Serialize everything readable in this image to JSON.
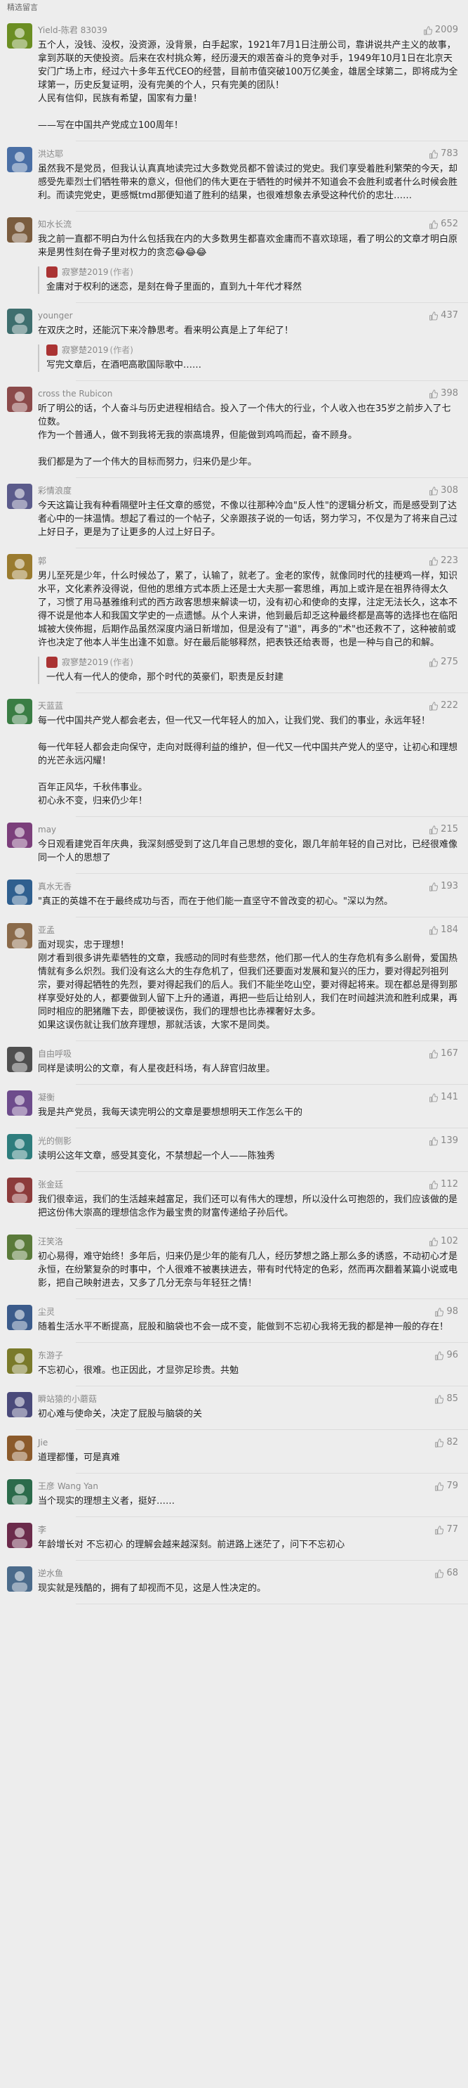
{
  "section_title": "精选留言",
  "author_name": "寂寥楚2019",
  "author_tag": "(作者)",
  "comments": [
    {
      "name": "Yield-陈君 83039",
      "likes": "2009",
      "text": "五个人，没钱、没权，没资源，没背景，白手起家，1921年7月1日注册公司，靠讲说共产主义的故事，拿到苏联的天使投资。后来在农村挑众筹，经历漫天的艰苦奋斗的竞争对手，1949年10月1日在北京天安门广场上市，经过六十多年五代CEO的经营，目前市值突破100万亿美金，雄居全球第二，即将成为全球第一，历史反复证明，没有完美的个人，只有完美的团队！\n人民有信仰，民族有希望，国家有力量！\n\n——写在中国共产党成立100周年！",
      "reply": null
    },
    {
      "name": "洪达耶",
      "likes": "783",
      "text": "虽然我不是党员，但我认认真真地读完过大多数党员都不曾读过的党史。我们享受着胜利繁荣的今天，却感受先辈烈士们牺牲带来的意义，但他们的伟大更在于牺牲的时候并不知道会不会胜利或者什么时候会胜利。而读完党史，更感慨tmd那便知道了胜利的结果，也很难想象去承受这种代价的忠壮……",
      "reply": null
    },
    {
      "name": "知水长流",
      "likes": "652",
      "text": "我之前一直都不明白为什么包括我在内的大多数男生都喜欢金庸而不喜欢琼瑶，看了明公的文章才明白原来是男性刻在骨子里对权力的贪恋😂😂😂",
      "reply": {
        "likes": "",
        "text": "金庸对于权利的迷恋，是刻在骨子里面的，直到九十年代才释然"
      }
    },
    {
      "name": "younger",
      "likes": "437",
      "text": "在双庆之时，还能沉下来冷静思考。看来明公真是上了年纪了！",
      "reply": {
        "likes": "",
        "text": "写完文章后，在酒吧高歌国际歌中……"
      }
    },
    {
      "name": "cross the Rubicon",
      "likes": "398",
      "text": "听了明公的话，个人奋斗与历史进程相结合。投入了一个伟大的行业，个人收入也在35岁之前步入了七位数。\n作为一个普通人，做不到我将无我的崇高境界，但能做到鸡鸣而起，奋不顾身。\n\n我们都是为了一个伟大的目标而努力，归来仍是少年。",
      "reply": null
    },
    {
      "name": "彩情浪度",
      "likes": "308",
      "text": "今天这篇让我有种看隔壁叶主任文章的感觉，不像以往那种冷血\"反人性\"的逻辑分析文，而是感受到了达者心中的一抹温情。想起了看过的一个帖子，父亲跟孩子说的一句话，努力学习，不仅是为了将来自己过上好日子，更是为了让更多的人过上好日子。",
      "reply": null
    },
    {
      "name": "郭",
      "likes": "223",
      "text": "男儿至死是少年，什么时候怂了，累了，认输了，就老了。金老的家传，就像同时代的挂梗鸡一样，知识水平，文化素养没得说，但他的思维方式本质上还是士大夫那一套思维，再加上或许是在祖界待得太久了，习惯了用马基雅维利式的西方政客思想来解读一切，没有初心和使命的支撑，注定无法长久，这本不得不说是他本人和我国文学史的一点遗憾。从个人来讲，他到最后却乏这种最终都是高等的选择也在临阳城被大侠佈掘，后期作品虽然深度内涵日新增加，但是没有了\"道\"，再多的\"术\"也还救不了，这种被前或许也决定了他本人半生出逢不如意。好在最后能够释然，把表铁还给表哥，也是一种与自己的和解。",
      "reply": {
        "likes": "275",
        "text": "一代人有一代人的使命，那个时代的英豪们，职责是反封建"
      }
    },
    {
      "name": "天蓝蓝",
      "likes": "222",
      "text": "每一代中国共产党人都会老去，但一代又一代年轻人的加入，让我们党、我们的事业，永远年轻！\n\n每一代年轻人都会走向保守，走向对既得利益的维护，但一代又一代中国共产党人的坚守，让初心和理想的光芒永远闪耀！\n\n百年正风华，千秋伟事业。\n初心永不变，归来仍少年！",
      "reply": null
    },
    {
      "name": "may",
      "likes": "215",
      "text": "今日观看建党百年庆典，我深刻感受到了这几年自己思想的变化，跟几年前年轻的自己对比，已经很难像同一个人的思想了",
      "reply": null
    },
    {
      "name": "真水无香",
      "likes": "193",
      "text": "\"真正的英雄不在于最终成功与否，而在于他们能一直坚守不曾改变的初心。\"深以为然。",
      "reply": null
    },
    {
      "name": "亚孟",
      "likes": "184",
      "text": "面对现实，忠于理想！\n刚才看到很多讲先辈牺牲的文章，我感动的同时有些悲然，他们那一代人的生存危机有多么剧骨，爱国热情就有多么炽烈。我们没有这么大的生存危机了，但我们还要面对发展和复兴的压力，要对得起列祖列宗，要对得起牺牲的先烈，要对得起我们的后人。我们不能坐吃山空，要对得起将来。现在都总是得到那样享受好处的人，都要做到人留下上升的通道，再把一些后让给别人，我们在时间越洪流和胜利成果，再同时相应的肥猪雕下去，即便被误伤，我们的理想也比赤裸奢好太多。\n如果这误伤就让我们放弃理想，那就活该，大家不是同类。",
      "reply": null
    },
    {
      "name": "自由呼吸",
      "likes": "167",
      "text": "同样是读明公的文章，有人星夜赶科场，有人辞官归故里。",
      "reply": null
    },
    {
      "name": "凝衡",
      "likes": "141",
      "text": "我是共产党员，我每天读完明公的文章是要想想明天工作怎么干的",
      "reply": null
    },
    {
      "name": "光的侧影",
      "likes": "139",
      "text": "读明公这年文章，感受其变化，不禁想起一个人——陈独秀",
      "reply": null
    },
    {
      "name": "张金廷",
      "likes": "112",
      "text": "我们很幸运，我们的生活越来越富足，我们还可以有伟大的理想，所以没什么可抱怨的，我们应该做的是把这份伟大崇高的理想信念作为最宝贵的财富传递给子孙后代。",
      "reply": null
    },
    {
      "name": "汪笑洛",
      "likes": "102",
      "text": "初心易得，难守始终！多年后，归来仍是少年的能有几人，经历梦想之路上那么多的诱惑，不动初心才是永恒，在纷繁复杂的时事中，个人很难不被裹挟进去，带有时代特定的色彩，然而再次翻着某篇小说或电影，把自己映射进去，又多了几分无奈与年轻狂之情！",
      "reply": null
    },
    {
      "name": "尘灵",
      "likes": "98",
      "text": "随着生活水平不断提高，屁股和脑袋也不会一成不变，能做到不忘初心我将无我的都是神一般的存在！",
      "reply": null
    },
    {
      "name": "东游子",
      "likes": "96",
      "text": "不忘初心，很难。也正因此，才显弥足珍贵。共勉",
      "reply": null
    },
    {
      "name": "瞬站猿的小蘑菇",
      "likes": "85",
      "text": "初心难与使命关，决定了屁股与脑袋的关",
      "reply": null
    },
    {
      "name": "Jie",
      "likes": "82",
      "text": "道理都懂，可是真难",
      "reply": null
    },
    {
      "name": "王彦 Wang Yan",
      "likes": "79",
      "text": "当个现实的理想主义者，挺好……",
      "reply": null
    },
    {
      "name": "李",
      "likes": "77",
      "text": "年龄增长对 不忘初心 的理解会越来越深刻。前进路上迷茫了，问下不忘初心",
      "reply": null
    },
    {
      "name": "逆水鱼",
      "likes": "68",
      "text": "现实就是残酷的，拥有了却视而不见，这是人性决定的。",
      "reply": null
    }
  ]
}
